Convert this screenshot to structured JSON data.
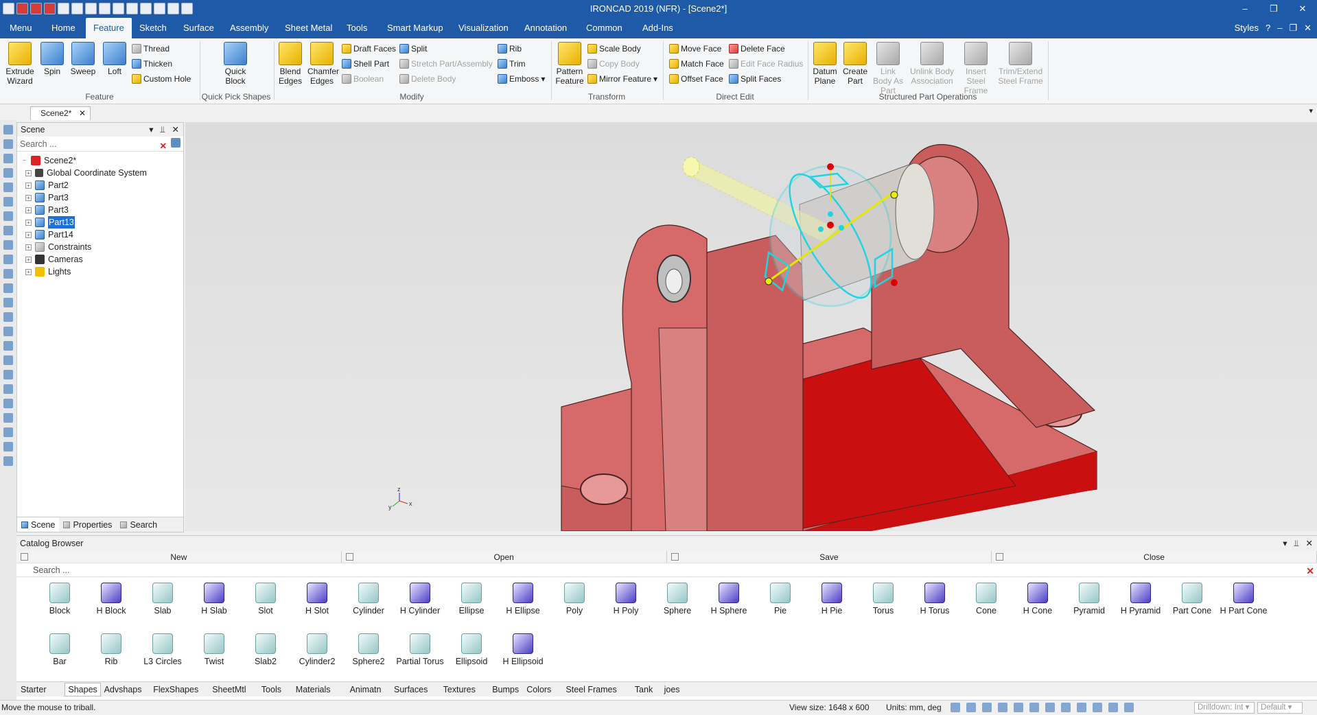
{
  "window": {
    "title": "IRONCAD 2019 (NFR) - [Scene2*]"
  },
  "menu": {
    "tabs": [
      "Menu",
      "Home",
      "Feature",
      "Sketch",
      "Surface",
      "Assembly",
      "Sheet Metal",
      "Tools",
      "Smart Markup",
      "Visualization",
      "Annotation",
      "Common",
      "Add-Ins"
    ],
    "active": "Feature",
    "styles": "Styles"
  },
  "ribbon": {
    "extrude": "Extrude Wizard",
    "spin": "Spin",
    "sweep": "Sweep",
    "loft": "Loft",
    "thread": "Thread",
    "thicken": "Thicken",
    "custom_hole": "Custom Hole",
    "quick_block": "Quick Block",
    "blend": "Blend Edges",
    "chamfer": "Chamfer Edges",
    "draft": "Draft Faces",
    "shell": "Shell Part",
    "boolean": "Boolean",
    "split": "Split",
    "stretch": "Stretch Part/Assembly",
    "delete_body": "Delete Body",
    "rib": "Rib",
    "trim": "Trim",
    "emboss": "Emboss",
    "pattern": "Pattern Feature",
    "scale_body": "Scale Body",
    "copy_body": "Copy Body",
    "mirror": "Mirror Feature",
    "move_face": "Move Face",
    "match_face": "Match Face",
    "offset_face": "Offset Face",
    "delete_face": "Delete Face",
    "edit_radius": "Edit Face Radius",
    "split_faces": "Split Faces",
    "datum": "Datum Plane",
    "create_part": "Create Part",
    "link_body": "Link Body As Part",
    "unlink_body": "Unlink Body Association",
    "insert_steel": "Insert Steel Frame",
    "trim_steel": "Trim/Extend Steel Frame",
    "groups": {
      "feature": "Feature",
      "quick": "Quick Pick Shapes",
      "modify": "Modify",
      "transform": "Transform",
      "direct": "Direct Edit",
      "structured": "Structured Part Operations"
    }
  },
  "doc_tab": "Scene2*",
  "scene": {
    "title": "Scene",
    "search_placeholder": "Search ...",
    "tree": [
      "Scene2*",
      "Global Coordinate System",
      "Part2",
      "Part3",
      "Part3",
      "Part13",
      "Part14",
      "Constraints",
      "Cameras",
      "Lights"
    ],
    "selected": "Part13",
    "tabs": [
      "Scene",
      "Properties",
      "Search"
    ]
  },
  "catalog": {
    "title": "Catalog Browser",
    "actions": [
      "New",
      "Open",
      "Save",
      "Close"
    ],
    "search_placeholder": "Search ...",
    "shapes_row1": [
      "Block",
      "H Block",
      "Slab",
      "H Slab",
      "Slot",
      "H Slot",
      "Cylinder",
      "H Cylinder",
      "Ellipse",
      "H Ellipse",
      "Poly",
      "H Poly",
      "Sphere",
      "H Sphere",
      "Pie",
      "H Pie",
      "Torus",
      "H Torus",
      "Cone",
      "H Cone",
      "Pyramid",
      "H Pyramid",
      "Part Cone",
      "H Part Cone"
    ],
    "shapes_row2": [
      "Bar",
      "Rib",
      "L3 Circles",
      "Twist",
      "Slab2",
      "Cylinder2",
      "Sphere2",
      "Partial Torus",
      "Ellipsoid",
      "H Ellipsoid"
    ],
    "tabs": [
      "Starter",
      "Shapes",
      "Advshaps",
      "FlexShapes",
      "SheetMtl",
      "Tools",
      "Materials",
      "Animatn",
      "Surfaces",
      "Textures",
      "Bumps",
      "Colors",
      "Steel Frames",
      "Tank",
      "joes"
    ],
    "active_tab": "Shapes"
  },
  "status": {
    "message": "Move the mouse to triball.",
    "view_size": "View size: 1648 x  600",
    "units": "Units: mm, deg",
    "drilldown": "Drilldown: Int",
    "default": "Default"
  },
  "colors": {
    "brand": "#1e5aa8",
    "part_red": "#c95c5c",
    "selected": "#1e6fd6",
    "triball": "#22d3e0"
  }
}
